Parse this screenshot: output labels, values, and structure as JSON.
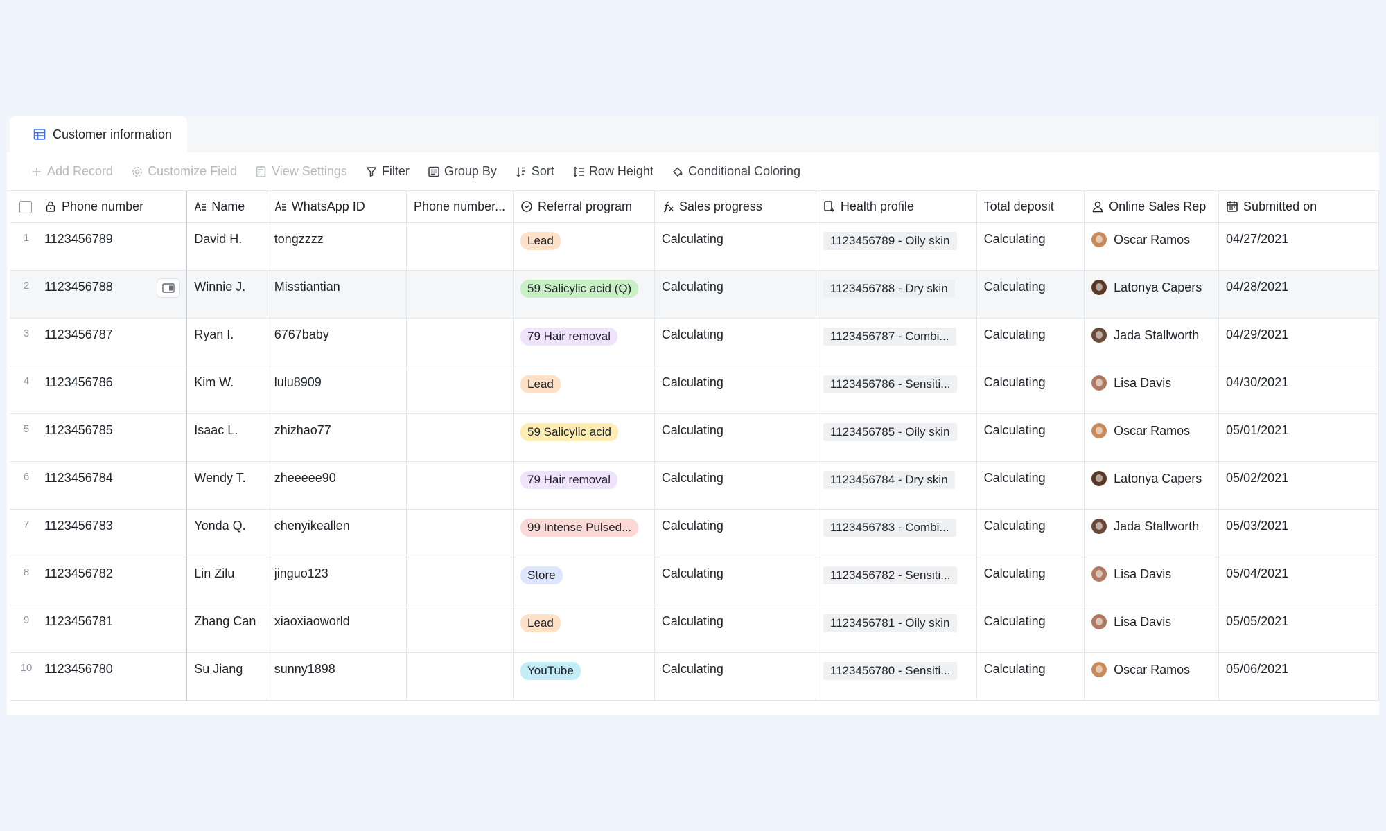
{
  "tab": {
    "label": "Customer information",
    "icon": "table-icon"
  },
  "toolbar": [
    {
      "label": "Add Record",
      "icon": "plus-icon",
      "disabled": true,
      "name": "add-record-button"
    },
    {
      "label": "Customize Field",
      "icon": "gear-icon",
      "disabled": true,
      "name": "customize-field-button"
    },
    {
      "label": "View Settings",
      "icon": "view-settings-icon",
      "disabled": true,
      "name": "view-settings-button"
    },
    {
      "label": "Filter",
      "icon": "filter-icon",
      "disabled": false,
      "name": "filter-button"
    },
    {
      "label": "Group By",
      "icon": "group-icon",
      "disabled": false,
      "name": "group-by-button"
    },
    {
      "label": "Sort",
      "icon": "sort-icon",
      "disabled": false,
      "name": "sort-button"
    },
    {
      "label": "Row Height",
      "icon": "row-height-icon",
      "disabled": false,
      "name": "row-height-button"
    },
    {
      "label": "Conditional Coloring",
      "icon": "paint-bucket-icon",
      "disabled": false,
      "name": "conditional-coloring-button"
    }
  ],
  "columns": [
    {
      "label": "Phone number",
      "icon": "lock-icon"
    },
    {
      "label": "Name",
      "icon": "text-field-icon"
    },
    {
      "label": "WhatsApp ID",
      "icon": "text-field-icon"
    },
    {
      "label": "Phone number...",
      "icon": ""
    },
    {
      "label": "Referral program",
      "icon": "single-select-icon"
    },
    {
      "label": "Sales progress",
      "icon": "formula-icon"
    },
    {
      "label": "Health profile",
      "icon": "link-record-icon"
    },
    {
      "label": "Total deposit",
      "icon": ""
    },
    {
      "label": "Online Sales Rep",
      "icon": "person-icon"
    },
    {
      "label": "Submitted on",
      "icon": "calendar-icon"
    }
  ],
  "tag_colors": {
    "Lead": {
      "bg": "#fde2c7",
      "fg": "#1f2329"
    },
    "59 Salicylic acid (Q)": {
      "bg": "#c9efc4",
      "fg": "#1f2329"
    },
    "79 Hair removal": {
      "bg": "#eee3fb",
      "fg": "#1f2329"
    },
    "59 Salicylic acid": {
      "bg": "#fdedb3",
      "fg": "#1f2329"
    },
    "99 Intense Pulsed...": {
      "bg": "#fcd9d6",
      "fg": "#1f2329"
    },
    "Store": {
      "bg": "#dde6fc",
      "fg": "#1f2329"
    },
    "YouTube": {
      "bg": "#c4ecf7",
      "fg": "#1f2329"
    }
  },
  "avatar_colors": {
    "Oscar Ramos": "#c98a5a",
    "Latonya Capers": "#5a3826",
    "Jada Stallworth": "#6b4a3a",
    "Lisa Davis": "#b07a62"
  },
  "rows": [
    {
      "num": "1",
      "phone": "1123456789",
      "name": "David H.",
      "whatsapp": "tongzzzz",
      "phone2": "",
      "referral": "Lead",
      "sales": "Calculating",
      "health": "1123456789 - Oily skin",
      "deposit": "Calculating",
      "rep": "Oscar Ramos",
      "submitted": "04/27/2021"
    },
    {
      "num": "2",
      "phone": "1123456788",
      "name": "Winnie J.",
      "whatsapp": "Misstiantian",
      "phone2": "",
      "referral": "59 Salicylic acid (Q)",
      "sales": "Calculating",
      "health": "1123456788 - Dry skin",
      "deposit": "Calculating",
      "rep": "Latonya Capers",
      "submitted": "04/28/2021",
      "hover": true
    },
    {
      "num": "3",
      "phone": "1123456787",
      "name": "Ryan I.",
      "whatsapp": "6767baby",
      "phone2": "",
      "referral": "79 Hair removal",
      "sales": "Calculating",
      "health": "1123456787 - Combi...",
      "deposit": "Calculating",
      "rep": "Jada Stallworth",
      "submitted": "04/29/2021"
    },
    {
      "num": "4",
      "phone": "1123456786",
      "name": "Kim W.",
      "whatsapp": "lulu8909",
      "phone2": "",
      "referral": "Lead",
      "sales": "Calculating",
      "health": "1123456786 - Sensiti...",
      "deposit": "Calculating",
      "rep": "Lisa Davis",
      "submitted": "04/30/2021"
    },
    {
      "num": "5",
      "phone": "1123456785",
      "name": "Isaac L.",
      "whatsapp": "zhizhao77",
      "phone2": "",
      "referral": "59 Salicylic acid",
      "sales": "Calculating",
      "health": "1123456785 - Oily skin",
      "deposit": "Calculating",
      "rep": "Oscar Ramos",
      "submitted": "05/01/2021"
    },
    {
      "num": "6",
      "phone": "1123456784",
      "name": "Wendy T.",
      "whatsapp": "zheeeee90",
      "phone2": "",
      "referral": "79 Hair removal",
      "sales": "Calculating",
      "health": "1123456784 - Dry skin",
      "deposit": "Calculating",
      "rep": "Latonya Capers",
      "submitted": "05/02/2021"
    },
    {
      "num": "7",
      "phone": "1123456783",
      "name": "Yonda Q.",
      "whatsapp": "chenyikeallen",
      "phone2": "",
      "referral": "99 Intense Pulsed...",
      "sales": "Calculating",
      "health": "1123456783 - Combi...",
      "deposit": "Calculating",
      "rep": "Jada Stallworth",
      "submitted": "05/03/2021"
    },
    {
      "num": "8",
      "phone": "1123456782",
      "name": "Lin Zilu",
      "whatsapp": "jinguo123",
      "phone2": "",
      "referral": "Store",
      "sales": "Calculating",
      "health": "1123456782 - Sensiti...",
      "deposit": "Calculating",
      "rep": "Lisa Davis",
      "submitted": "05/04/2021"
    },
    {
      "num": "9",
      "phone": "1123456781",
      "name": "Zhang Can",
      "whatsapp": "xiaoxiaoworld",
      "phone2": "",
      "referral": "Lead",
      "sales": "Calculating",
      "health": "1123456781 - Oily skin",
      "deposit": "Calculating",
      "rep": "Lisa Davis",
      "submitted": "05/05/2021"
    },
    {
      "num": "10",
      "phone": "1123456780",
      "name": "Su Jiang",
      "whatsapp": "sunny1898",
      "phone2": "",
      "referral": "YouTube",
      "sales": "Calculating",
      "health": "1123456780 - Sensiti...",
      "deposit": "Calculating",
      "rep": "Oscar Ramos",
      "submitted": "05/06/2021"
    }
  ]
}
